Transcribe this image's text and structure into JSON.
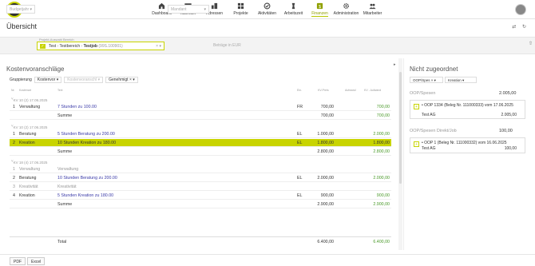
{
  "nav": {
    "logo": "T",
    "items": [
      {
        "label": "Dashboard",
        "icon": "dashboard-icon"
      },
      {
        "label": "Kalender",
        "icon": "calendar-icon"
      },
      {
        "label": "Adressen",
        "icon": "address-icon"
      },
      {
        "label": "Projekte",
        "icon": "projects-icon"
      },
      {
        "label": "Aktivitäten",
        "icon": "activities-icon"
      },
      {
        "label": "Arbeitszeit",
        "icon": "worktime-icon"
      },
      {
        "label": "Finanzen",
        "icon": "finance-icon",
        "active": true
      },
      {
        "label": "Administration",
        "icon": "admin-icon"
      },
      {
        "label": "Mitarbeiter",
        "icon": "employees-icon"
      }
    ]
  },
  "page": {
    "title": "Übersicht",
    "icons": "⇄ ↻"
  },
  "filter": {
    "budgetjahr": "Budgetjahr",
    "project_label": "Projekt-Auswahl Bereich",
    "project_a": "Test",
    "project_b": "Testbereich",
    "project_c": "Testjob",
    "project_code": "(99S.100901)",
    "mandant": "Mandant",
    "betraege": "Beträge in EUR"
  },
  "left": {
    "title": "Kostenvoranschläge",
    "gruppierung": "Gruppierung",
    "kostenvor": "Kostenvor",
    "kostenvoranschlag": "Kostenvoranschl",
    "genehmigt": "Genehmigt",
    "headers": {
      "nr": "Nr.",
      "position": "Kostenart",
      "text": "Text",
      "einheit": "Ein.",
      "kv": "KV-Preis",
      "aufwand": "Aufwand",
      "diff": "KV - Aufwand"
    },
    "groups": [
      {
        "label": "KV 10 (2) 17.06.2025",
        "rows": [
          {
            "nr": "1",
            "pos": "Verwaltung",
            "text": "7 Stunden zu 100.00",
            "ein": "FR",
            "kv": "700,00",
            "auf": "",
            "diff": "700,00"
          }
        ],
        "summe": {
          "label": "Summe",
          "kv": "700,00",
          "diff": "700,00"
        }
      },
      {
        "label": "KV 10 (2) 17.06.2025",
        "rows": [
          {
            "nr": "1",
            "pos": "Beratung",
            "text": "5 Stunden Beratung zu 200.00",
            "ein": "EL",
            "kv": "1.000,00",
            "auf": "",
            "diff": "2.000,00"
          },
          {
            "nr": "2",
            "pos": "Kreation",
            "text": "10 Stunden Kreation zu 180.00",
            "ein": "EL",
            "kv": "1.800,00",
            "auf": "",
            "diff": "1.800,00",
            "highlight": true
          }
        ],
        "summe": {
          "label": "Summe",
          "kv": "2.800,00",
          "diff": "2.800,00"
        }
      },
      {
        "label": "KV 18 (4) 17.06.2025",
        "rows": [
          {
            "nr": "1",
            "pos": "Verwaltung",
            "text": "Verwaltung",
            "ein": "",
            "kv": "",
            "auf": "",
            "diff": "",
            "muted": true
          },
          {
            "nr": "2",
            "pos": "Beratung",
            "text": "10 Stunden Beratung zu 200.00",
            "ein": "EL",
            "kv": "2.000,00",
            "auf": "",
            "diff": "2.000,00"
          },
          {
            "nr": "3",
            "pos": "Kreativität",
            "text": "Kreativität",
            "ein": "",
            "kv": "",
            "auf": "",
            "diff": "",
            "muted": true
          },
          {
            "nr": "4",
            "pos": "Kreation",
            "text": "5 Stunden Kreation zu 180.00",
            "ein": "EL",
            "kv": "900,00",
            "auf": "",
            "diff": "900,00"
          }
        ],
        "summe": {
          "label": "Summe",
          "kv": "2.900,00",
          "diff": "2.900,00"
        }
      }
    ],
    "total": {
      "label": "Total",
      "kv": "6.400,00",
      "diff": "6.400,00"
    }
  },
  "right": {
    "title": "Nicht zugeordnet",
    "sel1": "OOP/Spes",
    "sel2": "Kreation",
    "sec1": {
      "label": "OOP/Spesen",
      "value": "2.005,00",
      "item": {
        "line1": "OOP 1334 (Beleg Nr. 111000333) vom 17.06.2025",
        "line2": "Test AG",
        "value": "2.005,00"
      }
    },
    "sec2": {
      "label": "OOP/Spesen Direkt/Job",
      "value": "100,00",
      "item": {
        "line1": "OOP 1 (Beleg Nr. 111000332) vom 16.06.2025",
        "line2": "Test AG",
        "value": "100,00"
      }
    }
  },
  "footer": {
    "pdf": "PDF",
    "excel": "Excel"
  },
  "colors": {
    "accent": "#c8d400",
    "link": "#3a3aa8",
    "positive": "#4a9a2a"
  }
}
